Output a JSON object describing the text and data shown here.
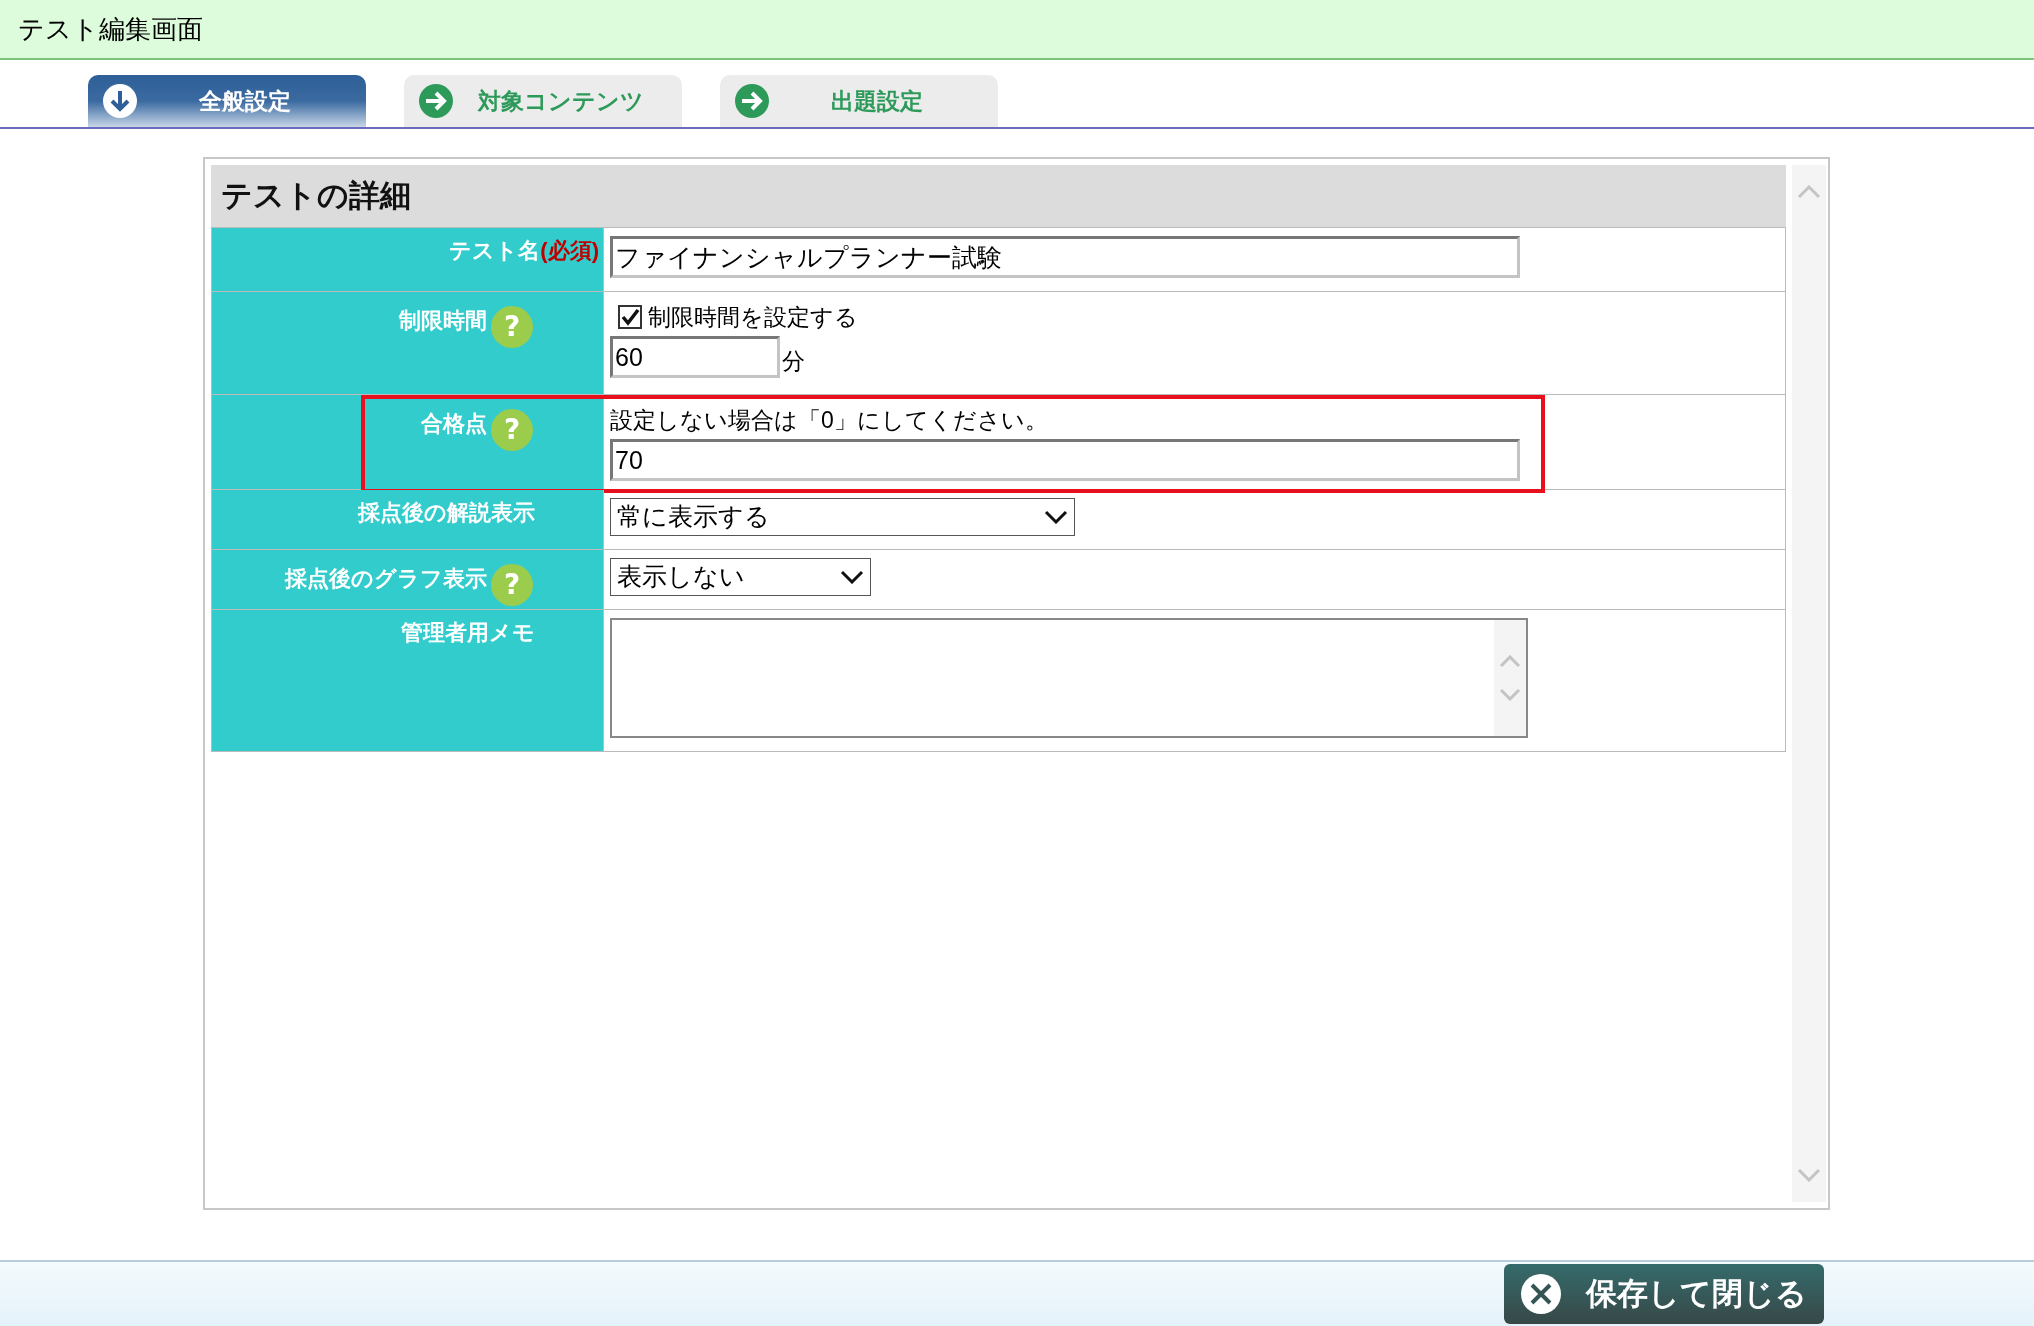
{
  "header": {
    "title": "テスト編集画面"
  },
  "tabs": [
    {
      "label": "全般設定",
      "selected": true
    },
    {
      "label": "対象コンテンツ",
      "selected": false
    },
    {
      "label": "出題設定",
      "selected": false
    }
  ],
  "panel": {
    "title": "テストの詳細",
    "rows": [
      {
        "kind": "text",
        "label": "テスト名",
        "required_mark": "(必須)",
        "value": "ファイナンシャルプランナー試験"
      },
      {
        "kind": "time",
        "label": "制限時間",
        "help_icon": "?",
        "checkbox_label": "制限時間を設定する",
        "checked": true,
        "value": "60",
        "unit": "分"
      },
      {
        "kind": "hint_text",
        "label": "合格点",
        "help_icon": "?",
        "highlighted": true,
        "hint": "設定しない場合は「0」にしてください。",
        "value": "70"
      },
      {
        "kind": "select",
        "label": "採点後の解説表示",
        "value": "常に表示する",
        "wide": true
      },
      {
        "kind": "select",
        "label": "採点後のグラフ表示",
        "help_icon": "?",
        "value": "表示しない",
        "wide": false
      },
      {
        "kind": "textarea",
        "label": "管理者用メモ"
      }
    ]
  },
  "footer": {
    "button": "保存して閉じる"
  }
}
